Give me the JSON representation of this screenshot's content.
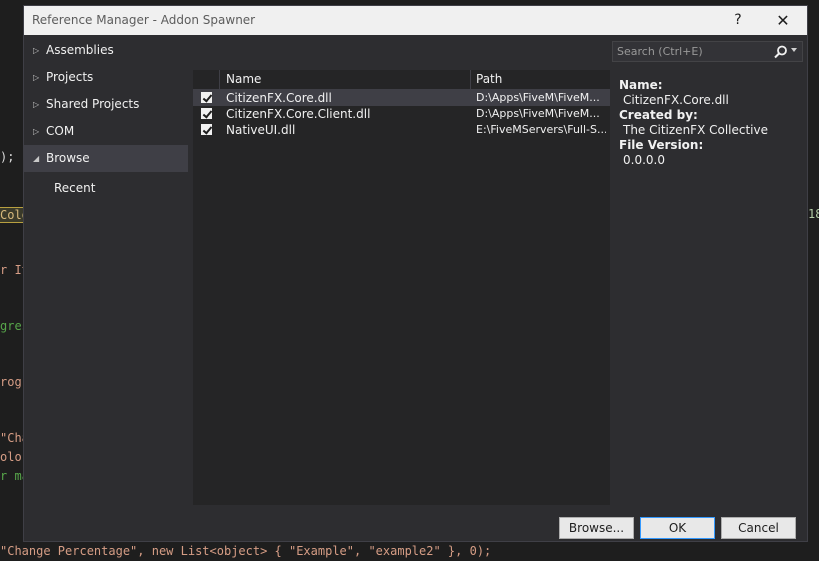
{
  "window": {
    "title": "Reference Manager - Addon Spawner",
    "help_glyph": "?",
    "close_glyph": "✕"
  },
  "sidebar": {
    "items": [
      {
        "label": "Assemblies",
        "arrow": "▷"
      },
      {
        "label": "Projects",
        "arrow": "▷"
      },
      {
        "label": "Shared Projects",
        "arrow": "▷"
      },
      {
        "label": "COM",
        "arrow": "▷"
      },
      {
        "label": "Browse",
        "arrow": "◢",
        "selected": true
      },
      {
        "label": "Recent",
        "child": true
      }
    ]
  },
  "search": {
    "placeholder": "Search (Ctrl+E)"
  },
  "list": {
    "columns": {
      "name": "Name",
      "path": "Path"
    },
    "rows": [
      {
        "checked": true,
        "name": "CitizenFX.Core.dll",
        "path": "D:\\Apps\\FiveM\\FiveM...",
        "selected": true
      },
      {
        "checked": true,
        "name": "CitizenFX.Core.Client.dll",
        "path": "D:\\Apps\\FiveM\\FiveM..."
      },
      {
        "checked": true,
        "name": "NativeUI.dll",
        "path": "E:\\FiveMServers\\Full-S..."
      }
    ]
  },
  "details": {
    "name_label": "Name:",
    "name_value": "CitizenFX.Core.dll",
    "created_label": "Created by:",
    "created_value": "The CitizenFX Collective",
    "version_label": "File Version:",
    "version_value": "0.0.0.0"
  },
  "buttons": {
    "browse": "Browse...",
    "ok": "OK",
    "cancel": "Cancel"
  },
  "background": {
    "frag1": ");",
    "frag2": "Colo",
    "frag3": "r It",
    "frag4": "gres",
    "frag5": "rogr",
    "frag6": "\"Cha",
    "frag7": "olor",
    "frag8": "r ma",
    "frag9": "18",
    "bottom_line": "\"Change Percentage\", new List<object> { \"Example\", \"example2\" }, 0);"
  },
  "colors": {
    "accent": "#3399ff",
    "dialog_bg": "#2d2d30",
    "list_bg": "#252526",
    "selection": "#3f3f46"
  }
}
